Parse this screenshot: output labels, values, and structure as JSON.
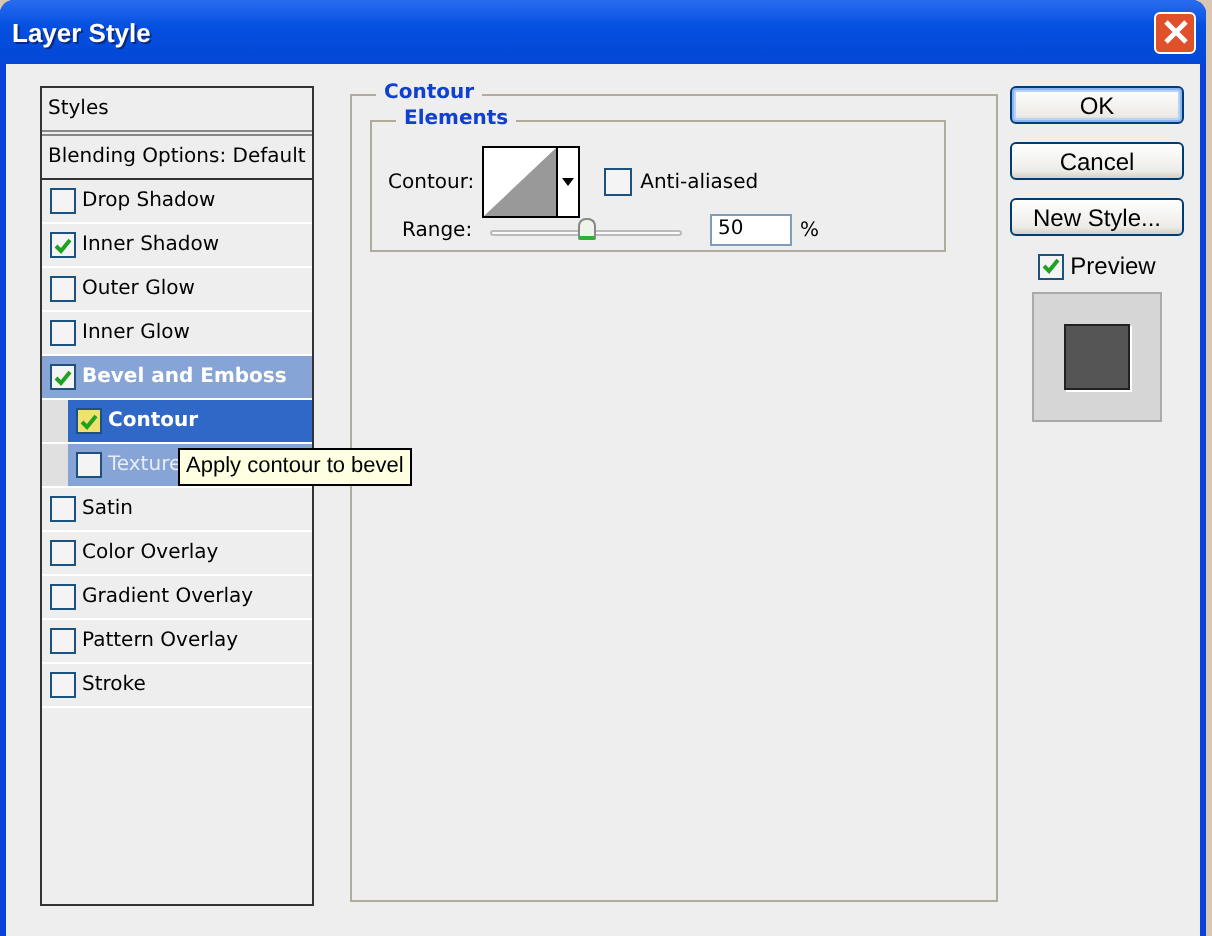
{
  "window": {
    "title": "Layer Style"
  },
  "styles_list": [
    {
      "kind": "header",
      "label": "Styles"
    },
    {
      "kind": "header",
      "label": "Blending Options: Default"
    },
    {
      "kind": "effect",
      "label": "Drop Shadow",
      "checked": false,
      "selected": false
    },
    {
      "kind": "effect",
      "label": "Inner Shadow",
      "checked": true,
      "selected": false
    },
    {
      "kind": "effect",
      "label": "Outer Glow",
      "checked": false,
      "selected": false
    },
    {
      "kind": "effect",
      "label": "Inner Glow",
      "checked": false,
      "selected": false
    },
    {
      "kind": "effect",
      "label": "Bevel and Emboss",
      "checked": true,
      "selected": false,
      "expanded": true,
      "children": [
        {
          "kind": "effect",
          "label": "Contour",
          "checked": true,
          "selected": true
        },
        {
          "kind": "effect",
          "label": "Texture",
          "checked": false,
          "selected": false
        }
      ]
    },
    {
      "kind": "effect",
      "label": "Satin",
      "checked": false,
      "selected": false
    },
    {
      "kind": "effect",
      "label": "Color Overlay",
      "checked": false,
      "selected": false
    },
    {
      "kind": "effect",
      "label": "Gradient Overlay",
      "checked": false,
      "selected": false
    },
    {
      "kind": "effect",
      "label": "Pattern Overlay",
      "checked": false,
      "selected": false
    },
    {
      "kind": "effect",
      "label": "Stroke",
      "checked": false,
      "selected": false
    }
  ],
  "tooltip": "Apply contour to bevel",
  "panel": {
    "title": "Contour",
    "group": {
      "title": "Elements",
      "contour_label": "Contour:",
      "anti_aliased": {
        "label": "Anti-aliased",
        "checked": false
      },
      "range": {
        "label": "Range:",
        "level": 0.5,
        "value": "50",
        "unit": "%"
      }
    }
  },
  "buttons": [
    {
      "label": "OK",
      "default": true
    },
    {
      "label": "Cancel",
      "default": false
    },
    {
      "label": "New Style...",
      "default": false
    }
  ],
  "preview": {
    "label": "Preview",
    "checked": true
  }
}
